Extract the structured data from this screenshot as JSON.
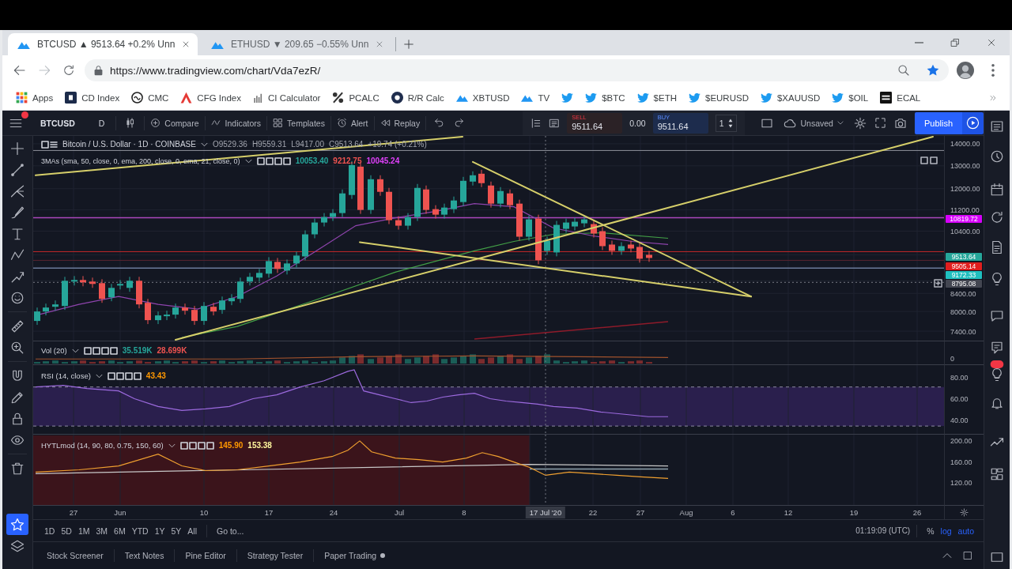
{
  "browser": {
    "tabs": [
      {
        "title": "BTCUSD ▲ 9513.64 +0.2% Unn",
        "selected": true
      },
      {
        "title": "ETHUSD ▼ 209.65 −0.55% Unn",
        "selected": false
      }
    ],
    "address": "https://www.tradingview.com/chart/Vda7ezR/",
    "bookmarks": [
      {
        "kind": "apps",
        "label": "Apps"
      },
      {
        "kind": "square",
        "label": "CD Index"
      },
      {
        "kind": "ring",
        "label": "CMC"
      },
      {
        "kind": "triangle",
        "label": "CFG Index"
      },
      {
        "kind": "bars",
        "label": "CI Calculator"
      },
      {
        "kind": "percent",
        "label": "PCALC"
      },
      {
        "kind": "disc",
        "label": "R/R Calc"
      },
      {
        "kind": "cloud",
        "label": "XBTUSD"
      },
      {
        "kind": "cloud",
        "label": "TV"
      },
      {
        "kind": "bird"
      },
      {
        "kind": "bird",
        "label": "$BTC"
      },
      {
        "kind": "bird",
        "label": "$ETH"
      },
      {
        "kind": "bird",
        "label": "$EURUSD"
      },
      {
        "kind": "bird",
        "label": "$XAUUSD"
      },
      {
        "kind": "bird",
        "label": "$OIL"
      },
      {
        "kind": "block",
        "label": "ECAL"
      }
    ]
  },
  "toolbar": {
    "symbol": "BTCUSD",
    "interval": "D",
    "tools": [
      {
        "kind": "compare",
        "label": "Compare"
      },
      {
        "kind": "indicators",
        "label": "Indicators"
      },
      {
        "kind": "templates",
        "label": "Templates"
      },
      {
        "kind": "alert",
        "label": "Alert"
      },
      {
        "kind": "replay",
        "label": "Replay"
      }
    ],
    "sell": {
      "label": "SELL",
      "price": "9511.64"
    },
    "spread": "0.00",
    "buy": {
      "label": "BUY",
      "price": "9511.64"
    },
    "quantity": "1",
    "layout": "Unsaved",
    "publish": "Publish"
  },
  "drawing_tools": [
    [
      {
        "kind": "cross",
        "selected": false
      },
      {
        "kind": "line",
        "selected": false
      },
      {
        "kind": "fork",
        "selected": false
      },
      {
        "kind": "brush",
        "selected": false
      },
      {
        "kind": "text",
        "selected": false
      },
      {
        "kind": "pattern",
        "selected": false
      },
      {
        "kind": "prediction",
        "selected": false
      },
      {
        "kind": "shapes",
        "selected": false
      }
    ],
    [
      {
        "kind": "ruler",
        "selected": false
      },
      {
        "kind": "zoom",
        "selected": false
      }
    ],
    [
      {
        "kind": "magnet",
        "selected": false
      },
      {
        "kind": "stay",
        "selected": false
      },
      {
        "kind": "lock",
        "selected": false
      },
      {
        "kind": "eye",
        "selected": false
      }
    ],
    [
      {
        "kind": "trash",
        "selected": false
      }
    ],
    [
      {
        "kind": "star",
        "selected": true
      },
      {
        "kind": "layers",
        "selected": false
      }
    ]
  ],
  "main_pane": {
    "title": "Bitcoin / U.S. Dollar · 1D · COINBASE",
    "ohlc": [
      "O9529.36",
      "H9559.31",
      "L9417.00",
      "C9513.64",
      "+19.74 (+0.21%)"
    ],
    "study": {
      "name": "3MAs (sma, 50, close, 0, ema, 200, close, 0, ema, 21, close, 0)",
      "values": [
        {
          "text": "10053.40",
          "color": "#26a69a"
        },
        {
          "text": "9212.75",
          "color": "#ef5350"
        },
        {
          "text": "10045.24",
          "color": "#e040fb"
        }
      ]
    },
    "price_ticks": [
      "14000.00",
      "13000.00",
      "12000.00",
      "11200.00",
      "10400.00",
      "8400.00",
      "8000.00",
      "7400.00"
    ],
    "price_labels": [
      {
        "text": "10819.72",
        "color": "#d500f9"
      },
      {
        "text": "9513.64",
        "color": "#26a69a"
      },
      {
        "text": "9505.14",
        "color": "#e01e1e"
      },
      {
        "text": "9172.33",
        "color": "#1fbfbf"
      },
      {
        "text": "8795.08",
        "color": "#434651"
      }
    ]
  },
  "volume_pane": {
    "name": "Vol (20)",
    "values": [
      {
        "text": "35.519K",
        "color": "#26a69a"
      },
      {
        "text": "28.699K",
        "color": "#ef5350"
      }
    ],
    "ticks": [
      "0"
    ]
  },
  "rsi_pane": {
    "name": "RSI (14, close)",
    "values": [
      {
        "text": "43.43",
        "color": "#ff9800"
      }
    ],
    "ticks": [
      "80.00",
      "60.00",
      "40.00"
    ]
  },
  "oscillator_pane": {
    "name": "HYTLmod (14, 90, 80, 0.75, 150, 60)",
    "values": [
      {
        "text": "145.90",
        "color": "#ff9800"
      },
      {
        "text": "153.38",
        "color": "#fff59d"
      }
    ],
    "ticks": [
      "200.00",
      "160.00",
      "120.00"
    ]
  },
  "time_axis": {
    "labels": [
      "27",
      "Jun",
      "10",
      "17",
      "24",
      "Jul",
      "8",
      "22",
      "27",
      "Aug",
      "6",
      "12",
      "19",
      "26"
    ],
    "crosshair_label": "17 Jul '20"
  },
  "range_bar": {
    "ranges": [
      "1D",
      "5D",
      "1M",
      "3M",
      "6M",
      "YTD",
      "1Y",
      "5Y",
      "All"
    ],
    "goto": "Go to...",
    "clock": "01:19:09 (UTC)",
    "scale_options": [
      {
        "label": "%",
        "on": false
      },
      {
        "label": "log",
        "on": true
      },
      {
        "label": "auto",
        "on": true
      }
    ]
  },
  "bottom_tabs": [
    {
      "label": "Stock Screener",
      "status_dot": false
    },
    {
      "label": "Text Notes",
      "status_dot": false
    },
    {
      "label": "Pine Editor",
      "status_dot": false
    },
    {
      "label": "Strategy Tester",
      "status_dot": false
    },
    {
      "label": "Paper Trading",
      "status_dot": true
    }
  ]
}
